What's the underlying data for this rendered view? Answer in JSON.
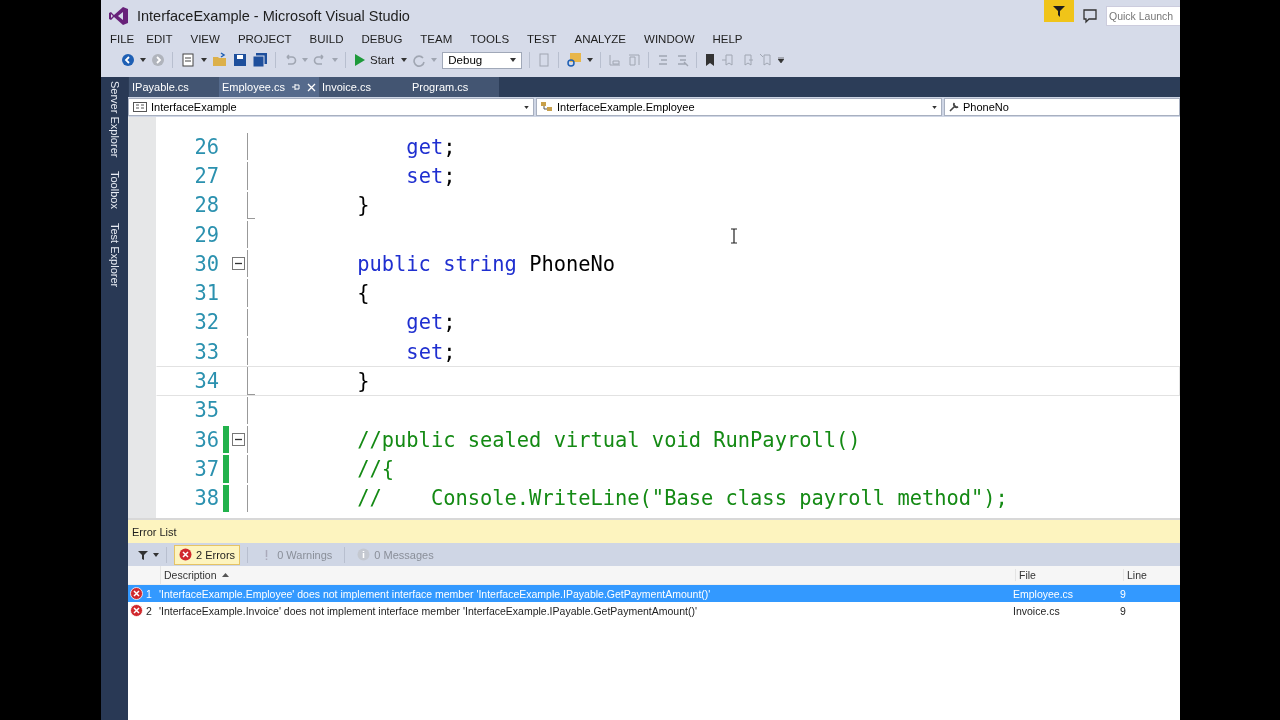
{
  "window": {
    "title": "InterfaceExample - Microsoft Visual Studio"
  },
  "quick_launch": {
    "placeholder": "Quick Launch"
  },
  "menu": [
    "FILE",
    "EDIT",
    "VIEW",
    "PROJECT",
    "BUILD",
    "DEBUG",
    "TEAM",
    "TOOLS",
    "TEST",
    "ANALYZE",
    "WINDOW",
    "HELP"
  ],
  "toolbar": {
    "start_label": "Start",
    "configuration": "Debug"
  },
  "side_tabs": [
    "Server Explorer",
    "Toolbox",
    "Test Explorer"
  ],
  "tabs": [
    {
      "label": "IPayable.cs",
      "selected": false
    },
    {
      "label": "Employee.cs",
      "selected": true
    },
    {
      "label": "Invoice.cs",
      "selected": false
    },
    {
      "label": "Program.cs",
      "selected": false
    }
  ],
  "navigation": {
    "project": "InterfaceExample",
    "type": "InterfaceExample.Employee",
    "member": "PhoneNo"
  },
  "code_lines": [
    {
      "number": "26",
      "kind": "accessor",
      "fold_start": false,
      "fold_end": false,
      "changed": false,
      "current": false,
      "tokens": [
        {
          "kind": "keyword",
          "text": "get"
        },
        {
          "kind": "punct",
          "text": ";"
        }
      ]
    },
    {
      "number": "27",
      "kind": "accessor",
      "fold_start": false,
      "fold_end": false,
      "changed": false,
      "current": false,
      "tokens": [
        {
          "kind": "keyword",
          "text": "set"
        },
        {
          "kind": "punct",
          "text": ";"
        }
      ]
    },
    {
      "number": "28",
      "kind": "member",
      "fold_start": false,
      "fold_end": true,
      "changed": false,
      "current": false,
      "tokens": [
        {
          "kind": "plain",
          "text": "}"
        }
      ]
    },
    {
      "number": "29",
      "fold_start": false,
      "fold_end": false,
      "changed": false,
      "current": false
    },
    {
      "number": "30",
      "kind": "member",
      "fold_start": true,
      "fold_end": false,
      "changed": false,
      "current": false,
      "tokens": [
        {
          "kind": "keyword",
          "text": "public"
        },
        {
          "kind": "keyword",
          "text": "string"
        },
        {
          "kind": "plain",
          "text": "PhoneNo"
        }
      ]
    },
    {
      "number": "31",
      "kind": "member",
      "fold_start": false,
      "fold_end": false,
      "changed": false,
      "current": false,
      "tokens": [
        {
          "kind": "plain",
          "text": "{"
        }
      ]
    },
    {
      "number": "32",
      "kind": "accessor",
      "fold_start": false,
      "fold_end": false,
      "changed": false,
      "current": false,
      "tokens": [
        {
          "kind": "keyword",
          "text": "get"
        },
        {
          "kind": "punct",
          "text": ";"
        }
      ]
    },
    {
      "number": "33",
      "kind": "accessor",
      "fold_start": false,
      "fold_end": false,
      "changed": false,
      "current": false,
      "tokens": [
        {
          "kind": "keyword",
          "text": "set"
        },
        {
          "kind": "punct",
          "text": ";"
        }
      ]
    },
    {
      "number": "34",
      "kind": "member",
      "fold_start": false,
      "fold_end": true,
      "changed": false,
      "current": true,
      "tokens": [
        {
          "kind": "plain",
          "text": "}"
        }
      ]
    },
    {
      "number": "35",
      "fold_start": false,
      "fold_end": false,
      "changed": false,
      "current": false
    },
    {
      "number": "36",
      "kind": "member",
      "fold_start": true,
      "fold_end": false,
      "changed": true,
      "current": false,
      "tokens": [
        {
          "kind": "comment",
          "text": "//public sealed virtual void RunPayroll()"
        }
      ]
    },
    {
      "number": "37",
      "kind": "member",
      "fold_start": false,
      "fold_end": false,
      "changed": true,
      "current": false,
      "tokens": [
        {
          "kind": "comment",
          "text": "//{"
        }
      ]
    },
    {
      "number": "38",
      "kind": "member",
      "fold_start": false,
      "fold_end": false,
      "changed": true,
      "current": false,
      "tokens": [
        {
          "kind": "comment",
          "text": "//    Console.WriteLine(\"Base class payroll method\");"
        }
      ]
    }
  ],
  "error_list": {
    "title": "Error List",
    "filters": [
      {
        "kind": "errors",
        "label": "2 Errors",
        "selected": true
      },
      {
        "kind": "warnings",
        "label": "0 Warnings",
        "selected": false
      },
      {
        "kind": "messages",
        "label": "0 Messages",
        "selected": false
      }
    ],
    "columns": [
      "Description",
      "File",
      "Line"
    ],
    "rows": [
      {
        "index": "1",
        "description": "'InterfaceExample.Employee' does not implement interface member 'InterfaceExample.IPayable.GetPaymentAmount()'",
        "file": "Employee.cs",
        "line": "9",
        "selected": true
      },
      {
        "index": "2",
        "description": "'InterfaceExample.Invoice' does not implement interface member 'InterfaceExample.IPayable.GetPaymentAmount()'",
        "file": "Invoice.cs",
        "line": "9",
        "selected": false
      }
    ]
  }
}
